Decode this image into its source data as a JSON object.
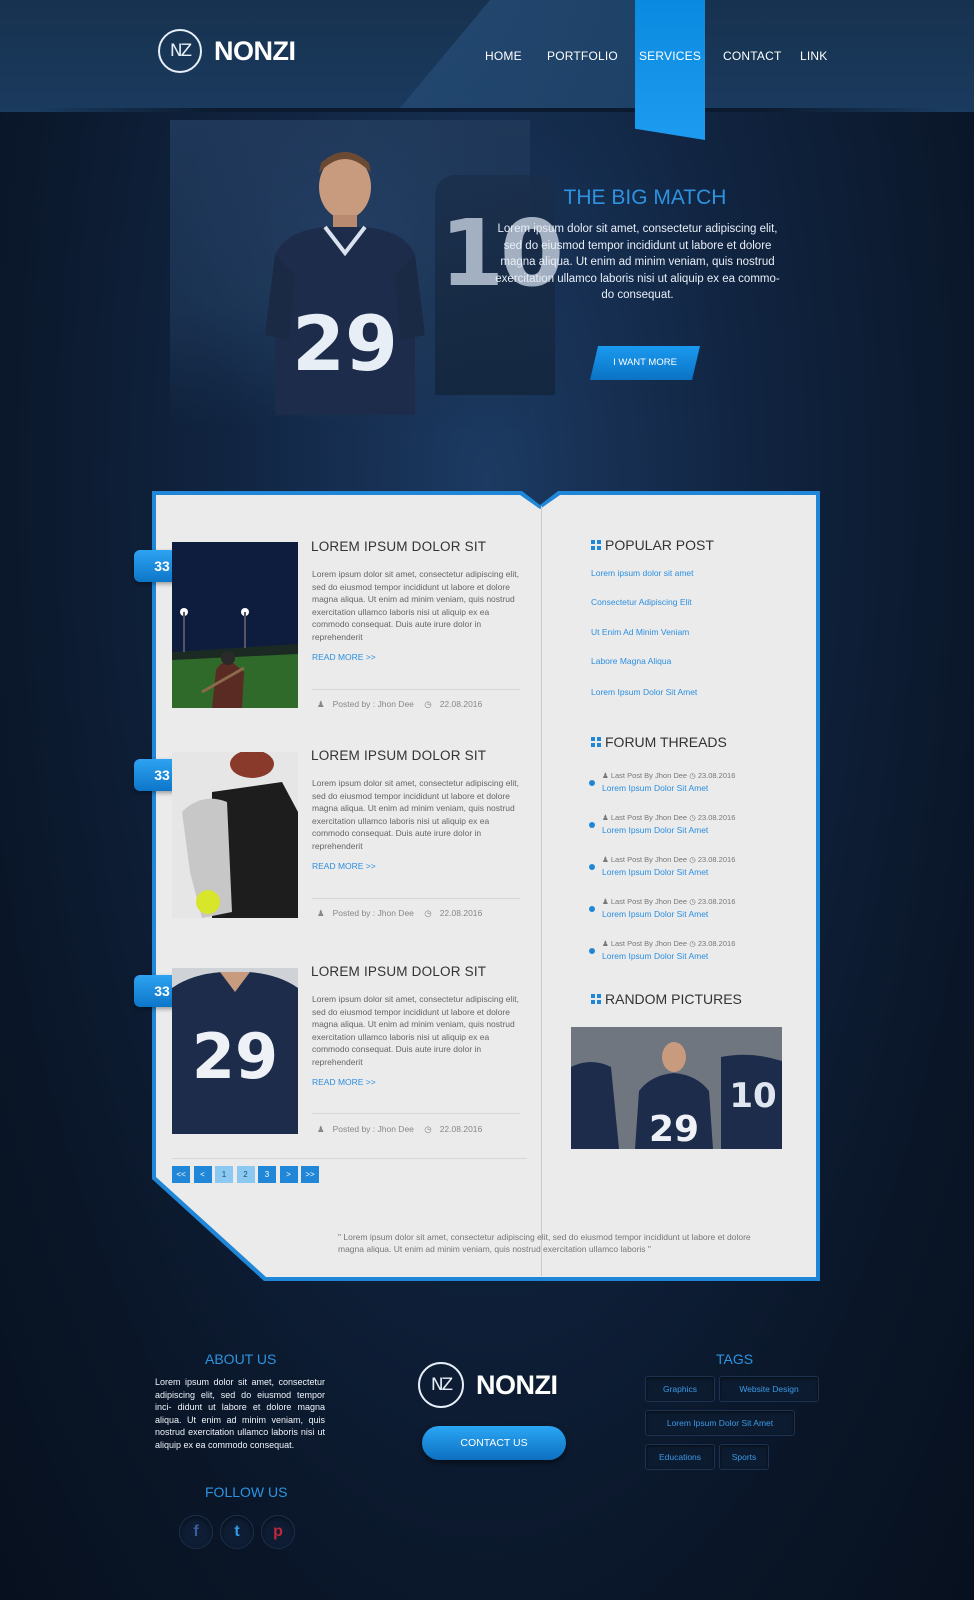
{
  "header": {
    "logo_mark": "NZ",
    "logo_text": "NONZI",
    "nav": [
      "HOME",
      "PORTFOLIO",
      "SERVICES",
      "CONTACT",
      "LINK"
    ],
    "active_nav": "SERVICES"
  },
  "hero": {
    "title": "THE BIG MATCH",
    "text": "Lorem ipsum dolor sit amet, consectetur adipiscing elit, sed do eiusmod tempor incididunt ut labore et dolore magna aliqua. Ut enim ad minim veniam, quis nostrud exercitation ullamco laboris nisi ut aliquip ex ea commo- do consequat.",
    "button": "I WANT MORE",
    "jersey_number": "29",
    "jersey_number_bg": "10"
  },
  "posts": [
    {
      "badge": "33",
      "title": "LOREM IPSUM DOLOR SIT",
      "body": "Lorem ipsum dolor sit amet, consectetur adipiscing elit, sed do eiusmod tempor incididunt ut labore et dolore magna aliqua. Ut enim ad minim veniam, quis nostrud exercitation ullamco laboris nisi ut aliquip ex ea commodo consequat. Duis aute irure dolor in reprehenderit",
      "read_more": "READ MORE >>",
      "author": "Posted by : Jhon Dee",
      "date": "22.08.2016"
    },
    {
      "badge": "33",
      "title": "LOREM IPSUM DOLOR SIT",
      "body": "Lorem ipsum dolor sit amet, consectetur adipiscing elit, sed do eiusmod tempor incididunt ut labore et dolore magna aliqua. Ut enim ad minim veniam, quis nostrud exercitation ullamco laboris nisi ut aliquip ex ea commodo consequat. Duis aute irure dolor in reprehenderit",
      "read_more": "READ MORE >>",
      "author": "Posted by : Jhon Dee",
      "date": "22.08.2016"
    },
    {
      "badge": "33",
      "title": "LOREM IPSUM DOLOR SIT",
      "body": "Lorem ipsum dolor sit amet, consectetur adipiscing elit, sed do eiusmod tempor incididunt ut labore et dolore magna aliqua. Ut enim ad minim veniam, quis nostrud exercitation ullamco laboris nisi ut aliquip ex ea commodo consequat. Duis aute irure dolor in reprehenderit",
      "read_more": "READ MORE >>",
      "author": "Posted by : Jhon Dee",
      "date": "22.08.2016"
    }
  ],
  "pagination": [
    "<<",
    "<",
    "1",
    "2",
    "3",
    ">",
    ">>"
  ],
  "quote": "\" Lorem ipsum dolor sit amet, consectetur adipiscing elit, sed do eiusmod tempor incididunt ut labore et dolore magna aliqua. Ut enim ad minim veniam, quis nostrud exercitation ullamco laboris \"",
  "sidebar": {
    "popular_title": "POPULAR POST",
    "popular": [
      "Lorem ipsum dolor sit amet",
      "Consectetur Adipiscing Elit",
      "Ut Enim Ad Minim Veniam",
      "Labore Magna Aliqua",
      "Lorem Ipsum Dolor Sit Amet"
    ],
    "forum_title": "FORUM THREADS",
    "threads": [
      {
        "meta": "Last Post By Jhon Dee",
        "date": "23.08.2016",
        "link": "Lorem Ipsum Dolor Sit Amet"
      },
      {
        "meta": "Last Post By Jhon Dee",
        "date": "23.08.2016",
        "link": "Lorem Ipsum Dolor Sit Amet"
      },
      {
        "meta": "Last Post By Jhon Dee",
        "date": "23.08.2016",
        "link": "Lorem Ipsum Dolor Sit Amet"
      },
      {
        "meta": "Last Post By Jhon Dee",
        "date": "23.08.2016",
        "link": "Lorem Ipsum Dolor Sit Amet"
      },
      {
        "meta": "Last Post By Jhon Dee",
        "date": "23.08.2016",
        "link": "Lorem Ipsum Dolor Sit Amet"
      }
    ],
    "random_title": "RANDOM PICTURES",
    "random_jersey_number": "29",
    "random_jersey_number_bg": "10"
  },
  "footer": {
    "about_title": "ABOUT US",
    "about_text": "Lorem ipsum dolor sit amet, consectetur adipiscing elit, sed do eiusmod tempor inci- didunt ut labore et dolore magna aliqua. Ut enim ad minim veniam, quis nostrud exercitation ullamco laboris nisi ut aliquip ex ea commodo consequat.",
    "follow_title": "FOLLOW US",
    "social_icons": [
      "facebook-icon",
      "twitter-icon",
      "pinterest-icon"
    ],
    "social_glyphs": [
      "f",
      "t",
      "p"
    ],
    "logo_mark": "NZ",
    "logo_text": "NONZI",
    "contact_button": "CONTACT US",
    "tags_title": "TAGS",
    "tags": [
      "Graphics",
      "Website Design",
      "Lorem Ipsum Dolor Sit Amet",
      "Educations",
      "Sports"
    ]
  },
  "colors": {
    "accent": "#1f86d8",
    "link": "#2b8fe0",
    "heading_blue": "#2d93e0",
    "background_dark": "#0a1628",
    "panel": "#ebebeb"
  }
}
